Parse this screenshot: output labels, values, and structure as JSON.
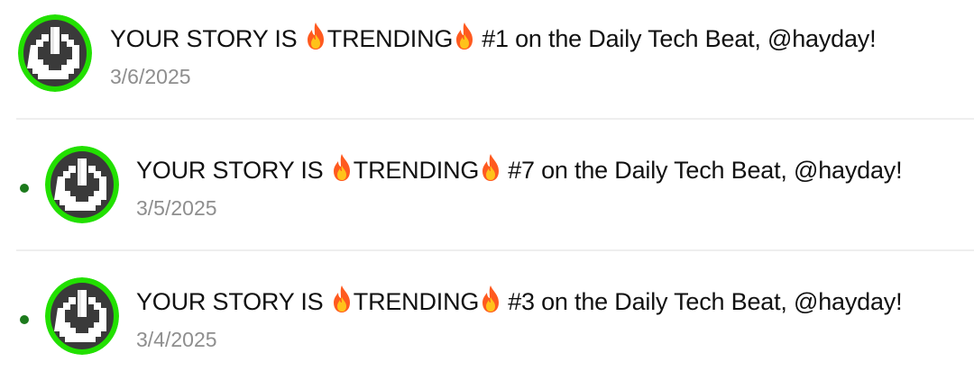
{
  "colors": {
    "avatar_ring": "#22e000",
    "avatar_bg": "#3a3a3a",
    "unread_dot": "#1c7a1c",
    "date_text": "#8e8e8e",
    "fire": "#ff5a1f"
  },
  "notifications": [
    {
      "unread": false,
      "avatar_icon": "power-pixel-icon",
      "title_prefix": "YOUR STORY IS ",
      "title_highlight": "TRENDING",
      "title_suffix": "#1 on the Daily Tech Beat, @hayday!",
      "date": "3/6/2025"
    },
    {
      "unread": true,
      "avatar_icon": "power-pixel-icon",
      "title_prefix": "YOUR STORY IS ",
      "title_highlight": "TRENDING",
      "title_suffix": "#7 on the Daily Tech Beat, @hayday!",
      "date": "3/5/2025"
    },
    {
      "unread": true,
      "avatar_icon": "power-pixel-icon",
      "title_prefix": "YOUR STORY IS ",
      "title_highlight": "TRENDING",
      "title_suffix": "#3 on the Daily Tech Beat, @hayday!",
      "date": "3/4/2025"
    }
  ]
}
